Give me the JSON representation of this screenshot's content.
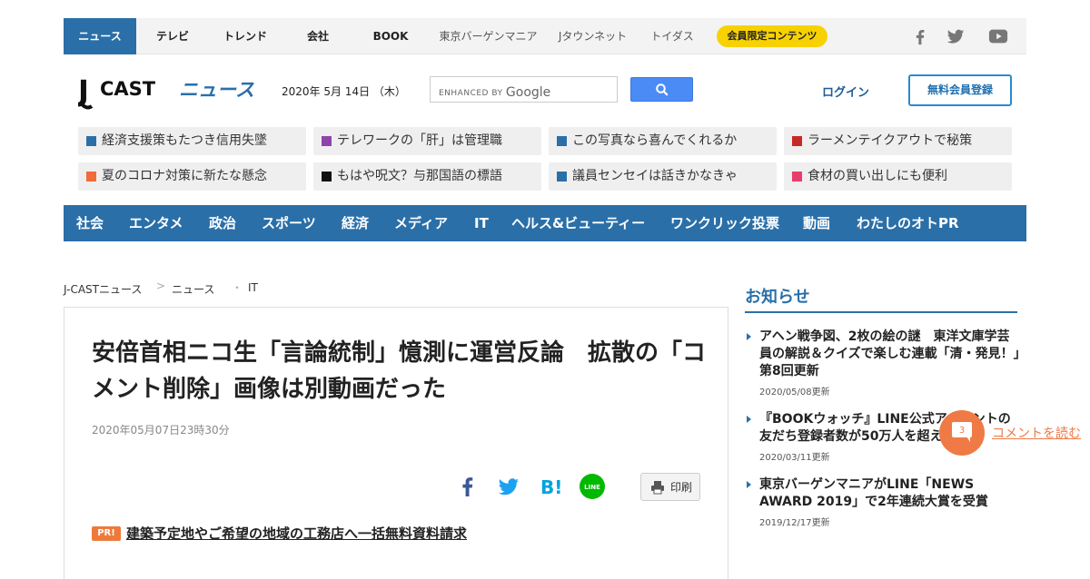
{
  "top_nav": {
    "items": [
      {
        "label": "ニュース",
        "active": true
      },
      {
        "label": "テレビ"
      },
      {
        "label": "トレンド"
      },
      {
        "label": "会社"
      },
      {
        "label": "BOOK"
      }
    ],
    "sub_items": [
      "東京バーゲンマニア",
      "Jタウンネット",
      "トイダス"
    ],
    "member_pill": "会員限定コンテンツ",
    "social_icons": [
      "facebook-icon",
      "twitter-icon",
      "youtube-icon"
    ]
  },
  "header": {
    "logo_j": "J",
    "logo_cast": "CAST",
    "logo_news": "ニュース",
    "date": "2020年 5月 14日 （木）",
    "search": {
      "enhanced_by": "ENHANCED BY",
      "google": "Google"
    },
    "login": "ログイン",
    "register": "無料会員登録"
  },
  "topics": [
    {
      "label": "経済支援策もたつき信用失墜",
      "color": "#2a6fa8"
    },
    {
      "label": "テレワークの「肝」は管理職",
      "color": "#8e44ad"
    },
    {
      "label": "この写真なら喜んでくれるか",
      "color": "#2a6fa8"
    },
    {
      "label": "ラーメンテイクアウトで秘策",
      "color": "#c62828"
    },
    {
      "label": "夏のコロナ対策に新たな懸念",
      "color": "#f26b3a"
    },
    {
      "label": "もはや呪文？与那国語の標語",
      "color": "#111111"
    },
    {
      "label": "議員センセイは話きかなきゃ",
      "color": "#2a6fa8"
    },
    {
      "label": "食材の買い出しにも便利",
      "color": "#e83e6b"
    }
  ],
  "categories": [
    "社会",
    "エンタメ",
    "政治",
    "スポーツ",
    "経済",
    "メディア",
    "IT",
    "ヘルス&ビューティー",
    "ワンクリック投票",
    "動画",
    "わたしのオトPR"
  ],
  "breadcrumb": [
    "J-CASTニュース",
    "ニュース",
    "IT"
  ],
  "article": {
    "headline": "安倍首相ニコ生「言論統制」憶測に運営反論　拡散の「コメント削除」画像は別動画だった",
    "published": "2020年05月07日23時30分",
    "share_icons": [
      "facebook-share-icon",
      "twitter-share-icon",
      "hatena-bookmark-icon",
      "line-share-icon"
    ],
    "print_label": "印刷",
    "pr_badge": "PR!",
    "pr_link": "建築予定地やご希望の地域の工務店へ一括無料資料請求"
  },
  "sidebar": {
    "title": "お知らせ",
    "items": [
      {
        "title": "アヘン戦争図、2枚の絵の謎　東洋文庫学芸員の解説＆クイズで楽しむ連載「清・発見！」第8回更新",
        "date": "2020/05/08更新"
      },
      {
        "title": "『BOOKウォッチ』LINE公式アカウントの友だち登録者数が50万人を超えました",
        "date": "2020/03/11更新"
      },
      {
        "title": "東京バーゲンマニアがLINE「NEWS AWARD 2019」で2年連続大賞を受賞",
        "date": "2019/12/17更新"
      }
    ]
  },
  "comments": {
    "count": "3",
    "label": "コメントを読む"
  }
}
